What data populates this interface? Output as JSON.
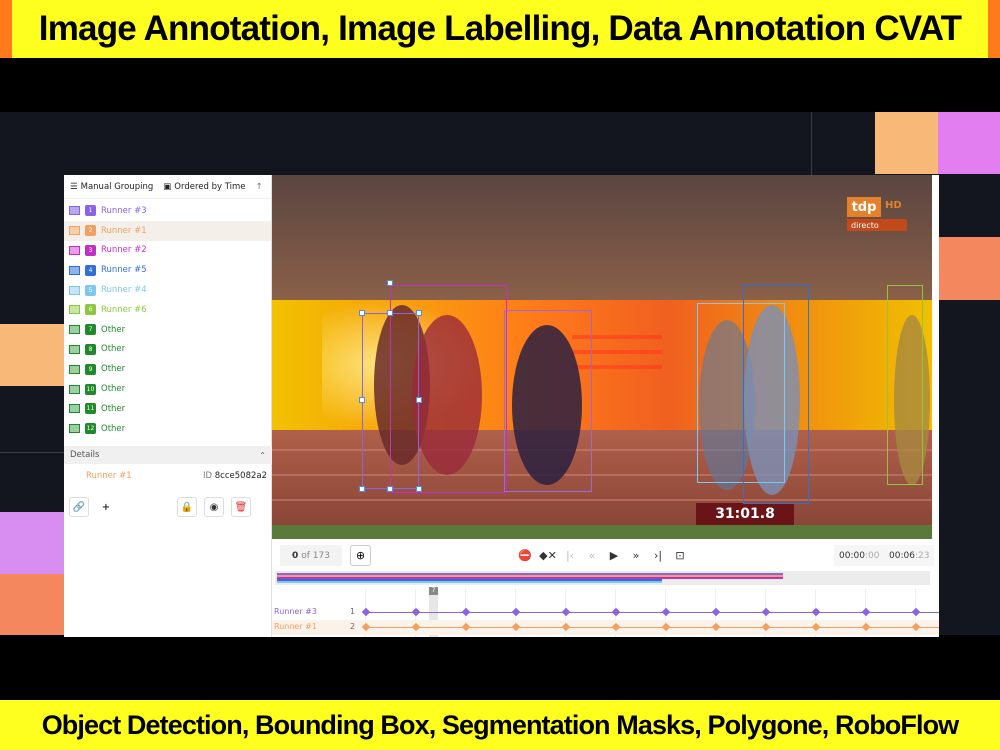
{
  "banner_top": "Image Annotation, Image Labelling, Data Annotation CVAT",
  "banner_bottom": "Object Detection, Bounding Box, Segmentation Masks, Polygone, RoboFlow",
  "sidebar": {
    "grouping_label": "Manual Grouping",
    "ordering_label": "Ordered by Time",
    "objects": [
      {
        "num": "1",
        "label": "Runner #3",
        "color": "#8a63e8"
      },
      {
        "num": "2",
        "label": "Runner #1",
        "color": "#f0a060"
      },
      {
        "num": "3",
        "label": "Runner #2",
        "color": "#c030c8"
      },
      {
        "num": "4",
        "label": "Runner #5",
        "color": "#2f6fd8"
      },
      {
        "num": "5",
        "label": "Runner #4",
        "color": "#7cc8f0"
      },
      {
        "num": "6",
        "label": "Runner #6",
        "color": "#8cc83c"
      },
      {
        "num": "7",
        "label": "Other",
        "color": "#1f8a2a"
      },
      {
        "num": "8",
        "label": "Other",
        "color": "#1f8a2a"
      },
      {
        "num": "9",
        "label": "Other",
        "color": "#1f8a2a"
      },
      {
        "num": "10",
        "label": "Other",
        "color": "#1f8a2a"
      },
      {
        "num": "11",
        "label": "Other",
        "color": "#1f8a2a"
      },
      {
        "num": "12",
        "label": "Other",
        "color": "#1f8a2a"
      }
    ],
    "details_title": "Details",
    "details_label": "Runner #1",
    "details_id_prefix": "ID",
    "details_id": "8cce5082a2"
  },
  "player": {
    "timecode": "31:01.8",
    "logo_text": "tdp",
    "logo_hd": "HD",
    "logo_sub": "directo",
    "frame_current": "0",
    "frame_of": "of 173",
    "time_current": "00:00",
    "time_current_ms": ":00",
    "time_total": "00:06",
    "time_total_ms": ":23"
  },
  "timeline": {
    "cursor_label": "7",
    "rows": [
      {
        "label": "Runner #3",
        "num": "1",
        "color": "#8a63e8"
      },
      {
        "label": "Runner #1",
        "num": "2",
        "color": "#f0a060"
      }
    ]
  }
}
